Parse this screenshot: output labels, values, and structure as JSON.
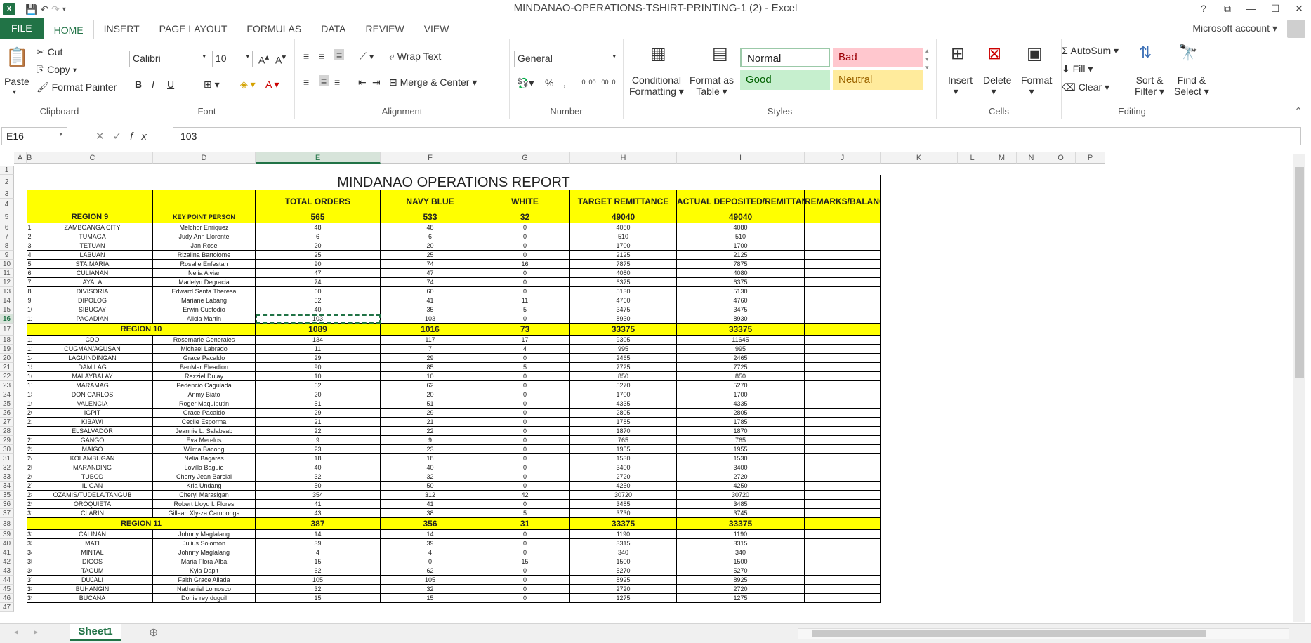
{
  "window": {
    "title": "MINDANAO-OPERATIONS-TSHIRT-PRINTING-1 (2) - Excel",
    "app_icon": "X"
  },
  "ribbon_tabs": [
    "FILE",
    "HOME",
    "INSERT",
    "PAGE LAYOUT",
    "FORMULAS",
    "DATA",
    "REVIEW",
    "VIEW"
  ],
  "account": "Microsoft account",
  "clipboard": {
    "paste": "Paste",
    "cut": "Cut",
    "copy": "Copy",
    "format_painter": "Format Painter",
    "label": "Clipboard"
  },
  "font": {
    "name": "Calibri",
    "size": "10",
    "label": "Font",
    "bold": "B",
    "italic": "I",
    "underline": "U"
  },
  "alignment": {
    "wrap": "Wrap Text",
    "merge": "Merge & Center",
    "label": "Alignment"
  },
  "number": {
    "format": "General",
    "percent": "%",
    "comma": ",",
    "inc_decimal": ".0 .00",
    "dec_decimal": ".00 .0",
    "label": "Number"
  },
  "styles": {
    "conditional": "Conditional",
    "formatting": "Formatting",
    "format_as": "Format as",
    "table": "Table",
    "normal": "Normal",
    "bad": "Bad",
    "good": "Good",
    "neutral": "Neutral",
    "label": "Styles"
  },
  "cells_group": {
    "insert": "Insert",
    "delete": "Delete",
    "format": "Format",
    "label": "Cells"
  },
  "editing": {
    "autosum": "AutoSum",
    "fill": "Fill",
    "clear": "Clear",
    "sort": "Sort &",
    "filter": "Filter",
    "find": "Find &",
    "select": "Select",
    "label": "Editing"
  },
  "formula_bar": {
    "name_box": "E16",
    "value": "103",
    "fx": "fx"
  },
  "columns": [
    "A",
    "B",
    "C",
    "D",
    "E",
    "F",
    "G",
    "H",
    "I",
    "J",
    "K",
    "L",
    "M",
    "N",
    "O",
    "P"
  ],
  "selected_cell": "E16",
  "report": {
    "title": "MINDANAO OPERATIONS REPORT",
    "headers": {
      "total": "TOTAL ORDERS",
      "navy": "NAVY BLUE",
      "white": "WHITE",
      "target": "TARGET REMITTANCE",
      "actual": "ACTUAL DEPOSITED/REMITTANCE",
      "remarks": "REMARKS/BALANCE"
    },
    "region_col_header": "REGION 9",
    "person_col_header": "KEY POINT PERSON",
    "sections": [
      {
        "row": 5,
        "name": "REGION 9",
        "total": "565",
        "navy": "533",
        "white": "32",
        "target": "49040",
        "actual": "49040"
      },
      {
        "row": 17,
        "name": "REGION 10",
        "total": "1089",
        "navy": "1016",
        "white": "73",
        "target": "33375",
        "actual": "33375"
      },
      {
        "row": 38,
        "name": "REGION 11",
        "total": "387",
        "navy": "356",
        "white": "31",
        "target": "33375",
        "actual": "33375"
      }
    ],
    "rows": [
      {
        "r": 6,
        "n": "1",
        "city": "ZAMBOANGA CITY",
        "person": "Melchor Enriquez",
        "t": "48",
        "nb": "48",
        "w": "0",
        "tg": "4080",
        "ac": "4080"
      },
      {
        "r": 7,
        "n": "2",
        "city": "TUMAGA",
        "person": "Judy Ann Llorente",
        "t": "6",
        "nb": "6",
        "w": "0",
        "tg": "510",
        "ac": "510"
      },
      {
        "r": 8,
        "n": "3",
        "city": "TETUAN",
        "person": "Jan Rose",
        "t": "20",
        "nb": "20",
        "w": "0",
        "tg": "1700",
        "ac": "1700"
      },
      {
        "r": 9,
        "n": "4",
        "city": "LABUAN",
        "person": "Rizalina Bartolome",
        "t": "25",
        "nb": "25",
        "w": "0",
        "tg": "2125",
        "ac": "2125"
      },
      {
        "r": 10,
        "n": "5",
        "city": "STA.MARIA",
        "person": "Rosalie Enfestan",
        "t": "90",
        "nb": "74",
        "w": "16",
        "tg": "7875",
        "ac": "7875"
      },
      {
        "r": 11,
        "n": "6",
        "city": "CULIANAN",
        "person": "Nelia Alviar",
        "t": "47",
        "nb": "47",
        "w": "0",
        "tg": "4080",
        "ac": "4080"
      },
      {
        "r": 12,
        "n": "7",
        "city": "AYALA",
        "person": "Madelyn Degracia",
        "t": "74",
        "nb": "74",
        "w": "0",
        "tg": "6375",
        "ac": "6375"
      },
      {
        "r": 13,
        "n": "8",
        "city": "DIVISORIA",
        "person": "Edward Santa Theresa",
        "t": "60",
        "nb": "60",
        "w": "0",
        "tg": "5130",
        "ac": "5130"
      },
      {
        "r": 14,
        "n": "9",
        "city": "DIPOLOG",
        "person": "Mariane Labang",
        "t": "52",
        "nb": "41",
        "w": "11",
        "tg": "4760",
        "ac": "4760"
      },
      {
        "r": 15,
        "n": "10",
        "city": "SIBUGAY",
        "person": "Erwin Custodio",
        "t": "40",
        "nb": "35",
        "w": "5",
        "tg": "3475",
        "ac": "3475"
      },
      {
        "r": 16,
        "n": "11",
        "city": "PAGADIAN",
        "person": "Alicia Martin",
        "t": "103",
        "nb": "103",
        "w": "0",
        "tg": "8930",
        "ac": "8930"
      },
      {
        "r": 18,
        "n": "12",
        "city": "CDO",
        "person": "Rosemarie Generales",
        "t": "134",
        "nb": "117",
        "w": "17",
        "tg": "9305",
        "ac": "11645"
      },
      {
        "r": 19,
        "n": "13",
        "city": "CUGMAN/AGUSAN",
        "person": "Michael Labrado",
        "t": "11",
        "nb": "7",
        "w": "4",
        "tg": "995",
        "ac": "995"
      },
      {
        "r": 20,
        "n": "14",
        "city": "LAGUINDINGAN",
        "person": "Grace Pacaldo",
        "t": "29",
        "nb": "29",
        "w": "0",
        "tg": "2465",
        "ac": "2465"
      },
      {
        "r": 21,
        "n": "15",
        "city": "DAMILAG",
        "person": "BenMar Eleadion",
        "t": "90",
        "nb": "85",
        "w": "5",
        "tg": "7725",
        "ac": "7725"
      },
      {
        "r": 22,
        "n": "16",
        "city": "MALAYBALAY",
        "person": "Rezziel Dulay",
        "t": "10",
        "nb": "10",
        "w": "0",
        "tg": "850",
        "ac": "850"
      },
      {
        "r": 23,
        "n": "17",
        "city": "MARAMAG",
        "person": "Pedencio Cagulada",
        "t": "62",
        "nb": "62",
        "w": "0",
        "tg": "5270",
        "ac": "5270"
      },
      {
        "r": 24,
        "n": "18",
        "city": "DON CARLOS",
        "person": "Anmy Biato",
        "t": "20",
        "nb": "20",
        "w": "0",
        "tg": "1700",
        "ac": "1700"
      },
      {
        "r": 25,
        "n": "19",
        "city": "VALENCIA",
        "person": "Roger Maquiputin",
        "t": "51",
        "nb": "51",
        "w": "0",
        "tg": "4335",
        "ac": "4335"
      },
      {
        "r": 26,
        "n": "20",
        "city": "IGPIT",
        "person": "Grace Pacaldo",
        "t": "29",
        "nb": "29",
        "w": "0",
        "tg": "2805",
        "ac": "2805"
      },
      {
        "r": 27,
        "n": "21",
        "city": "KIBAWI",
        "person": "Cecile Esporma",
        "t": "21",
        "nb": "21",
        "w": "0",
        "tg": "1785",
        "ac": "1785"
      },
      {
        "r": 28,
        "n": "",
        "city": "ELSALVADOR",
        "person": "Jeannie L. Salabsab",
        "t": "22",
        "nb": "22",
        "w": "0",
        "tg": "1870",
        "ac": "1870"
      },
      {
        "r": 29,
        "n": "22",
        "city": "GANGO",
        "person": "Eva Merelos",
        "t": "9",
        "nb": "9",
        "w": "0",
        "tg": "765",
        "ac": "765"
      },
      {
        "r": 30,
        "n": "23",
        "city": "MAIGO",
        "person": "Wilma Bacong",
        "t": "23",
        "nb": "23",
        "w": "0",
        "tg": "1955",
        "ac": "1955"
      },
      {
        "r": 31,
        "n": "24",
        "city": "KOLAMBUGAN",
        "person": "Nelia Bagares",
        "t": "18",
        "nb": "18",
        "w": "0",
        "tg": "1530",
        "ac": "1530"
      },
      {
        "r": 32,
        "n": "25",
        "city": "MARANDING",
        "person": "Lovilla Baguio",
        "t": "40",
        "nb": "40",
        "w": "0",
        "tg": "3400",
        "ac": "3400"
      },
      {
        "r": 33,
        "n": "26",
        "city": "TUBOD",
        "person": "Cherry Jean Barcial",
        "t": "32",
        "nb": "32",
        "w": "0",
        "tg": "2720",
        "ac": "2720"
      },
      {
        "r": 34,
        "n": "27",
        "city": "ILIGAN",
        "person": "Kria Undang",
        "t": "50",
        "nb": "50",
        "w": "0",
        "tg": "4250",
        "ac": "4250"
      },
      {
        "r": 35,
        "n": "28",
        "city": "OZAMIS/TUDELA/TANGUB",
        "person": "Cheryl Marasigan",
        "t": "354",
        "nb": "312",
        "w": "42",
        "tg": "30720",
        "ac": "30720"
      },
      {
        "r": 36,
        "n": "29",
        "city": "OROQUIETA",
        "person": "Robert Lloyd I. Flores",
        "t": "41",
        "nb": "41",
        "w": "0",
        "tg": "3485",
        "ac": "3485"
      },
      {
        "r": 37,
        "n": "31",
        "city": "CLARIN",
        "person": "Gillean Xly-za Cambonga",
        "t": "43",
        "nb": "38",
        "w": "5",
        "tg": "3730",
        "ac": "3745"
      },
      {
        "r": 39,
        "n": "32",
        "city": "CALINAN",
        "person": "Johnny Maglalang",
        "t": "14",
        "nb": "14",
        "w": "0",
        "tg": "1190",
        "ac": "1190"
      },
      {
        "r": 40,
        "n": "33",
        "city": "MATI",
        "person": "Julius Solomon",
        "t": "39",
        "nb": "39",
        "w": "0",
        "tg": "3315",
        "ac": "3315"
      },
      {
        "r": 41,
        "n": "34",
        "city": "MINTAL",
        "person": "Johnny Maglalang",
        "t": "4",
        "nb": "4",
        "w": "0",
        "tg": "340",
        "ac": "340"
      },
      {
        "r": 42,
        "n": "35",
        "city": "DIGOS",
        "person": "Maria Flora Alba",
        "t": "15",
        "nb": "0",
        "w": "15",
        "tg": "1500",
        "ac": "1500"
      },
      {
        "r": 43,
        "n": "36",
        "city": "TAGUM",
        "person": "Kyla Dapit",
        "t": "62",
        "nb": "62",
        "w": "0",
        "tg": "5270",
        "ac": "5270"
      },
      {
        "r": 44,
        "n": "37",
        "city": "DUJALI",
        "person": "Faith Grace Allada",
        "t": "105",
        "nb": "105",
        "w": "0",
        "tg": "8925",
        "ac": "8925"
      },
      {
        "r": 45,
        "n": "38",
        "city": "BUHANGIN",
        "person": "Nathaniel Lomosco",
        "t": "32",
        "nb": "32",
        "w": "0",
        "tg": "2720",
        "ac": "2720"
      },
      {
        "r": 46,
        "n": "39",
        "city": "BUCANA",
        "person": "Donie rey duguil",
        "t": "15",
        "nb": "15",
        "w": "0",
        "tg": "1275",
        "ac": "1275"
      }
    ]
  },
  "sheet_tab": "Sheet1",
  "colors": {
    "excel_green": "#217346",
    "highlight": "#ffff00"
  }
}
